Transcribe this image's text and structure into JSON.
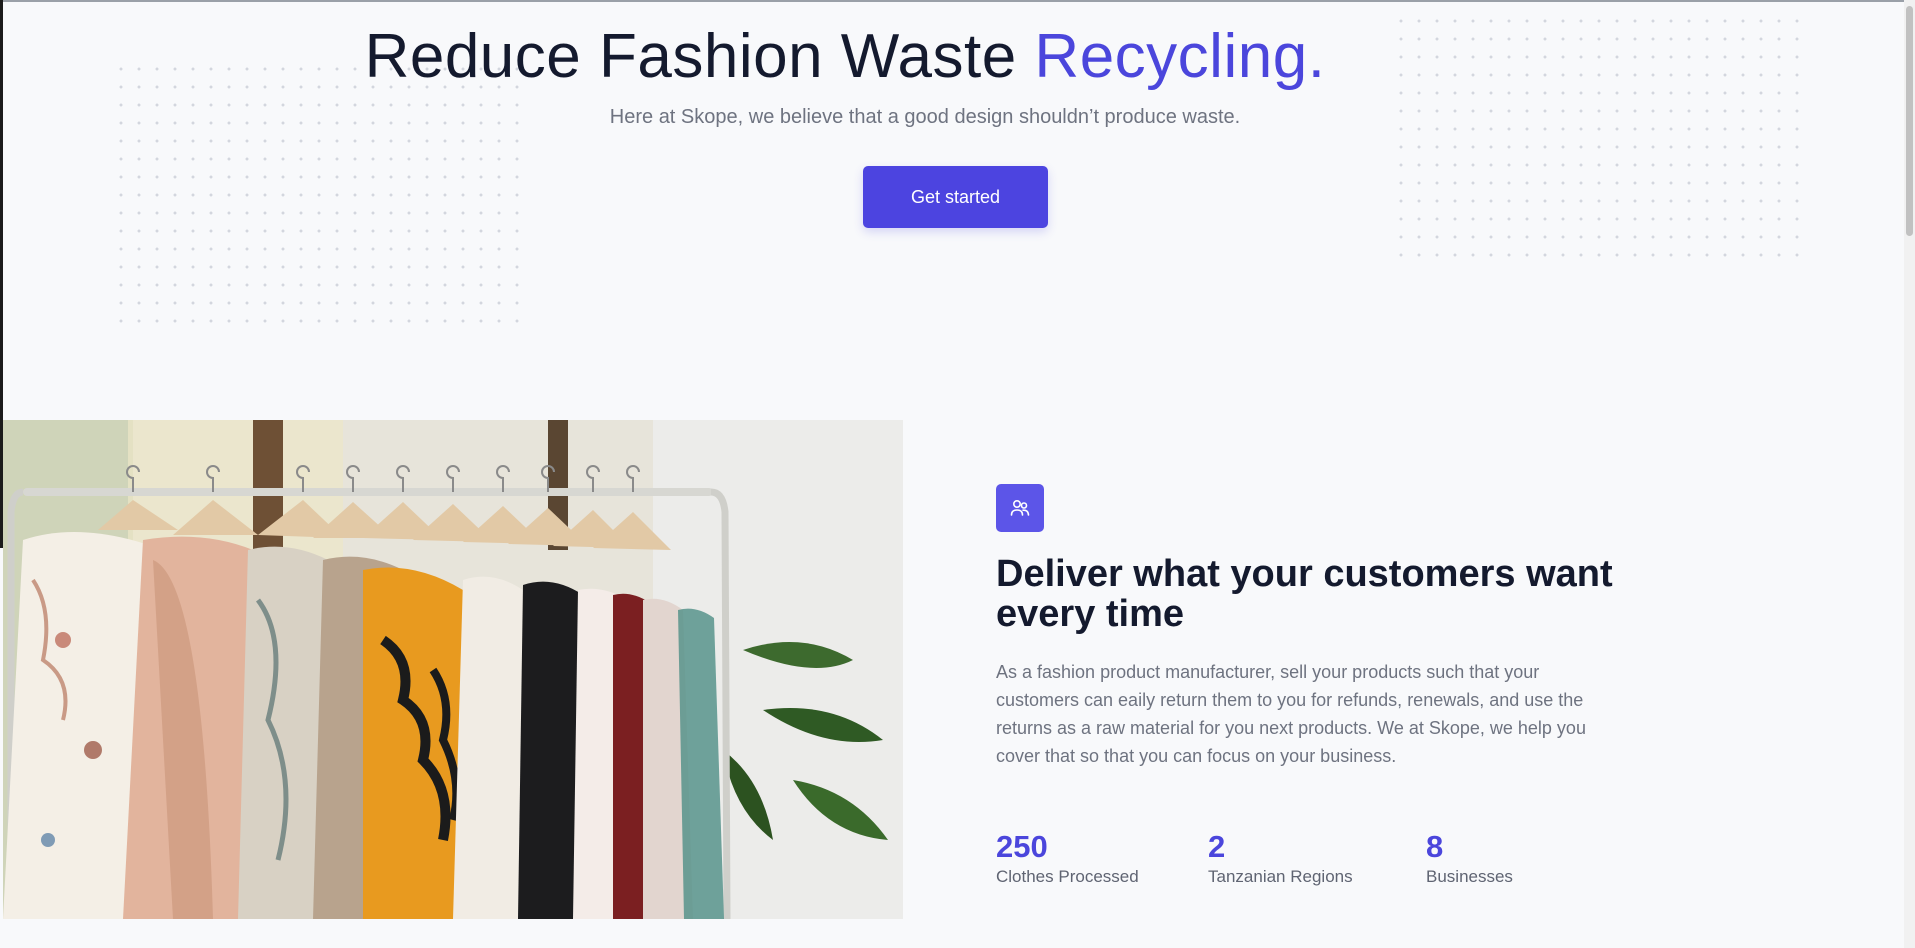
{
  "hero": {
    "title_main": "Reduce Fashion Waste ",
    "title_accent": "Recycling.",
    "subtitle": "Here at Skope, we believe that a good design shouldn’t produce waste.",
    "cta_label": "Get started"
  },
  "feature": {
    "icon": "users-icon",
    "title": "Deliver what your customers want every time",
    "body": "As a fashion product manufacturer, sell your products such that your customers can eaily return them to you for refunds, renewals, and use the returns as a raw material for you next products. We at Skope, we help you cover that so that you can focus on your business.",
    "stats": [
      {
        "value": "250",
        "label": "Clothes Processed"
      },
      {
        "value": "2",
        "label": "Tanzanian Regions"
      },
      {
        "value": "8",
        "label": "Businesses"
      }
    ]
  },
  "colors": {
    "accent": "#4b46dc",
    "button": "#4c44e0",
    "heading": "#141a2e",
    "background": "#f8f9fb"
  }
}
